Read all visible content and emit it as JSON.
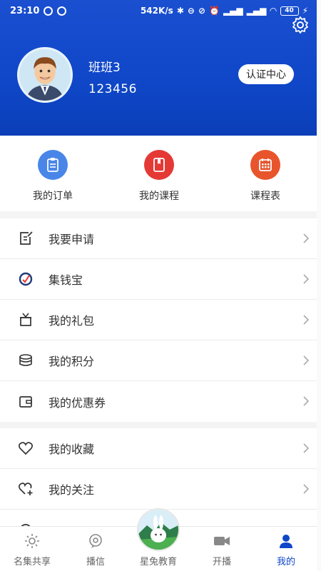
{
  "status_bar": {
    "time": "23:10",
    "speed": "542K/s",
    "battery": "40"
  },
  "profile": {
    "name": "班班3",
    "id": "123456",
    "auth_button": "认证中心"
  },
  "quick_actions": [
    {
      "label": "我的订单",
      "icon": "order-icon",
      "color": "#4a86e8"
    },
    {
      "label": "我的课程",
      "icon": "course-icon",
      "color": "#e53935"
    },
    {
      "label": "课程表",
      "icon": "calendar-icon",
      "color": "#e8552c"
    }
  ],
  "menu_group_1": [
    {
      "label": "我要申请",
      "icon": "apply-icon"
    },
    {
      "label": "集钱宝",
      "icon": "wallet-icon"
    },
    {
      "label": "我的礼包",
      "icon": "gift-icon"
    },
    {
      "label": "我的积分",
      "icon": "points-icon"
    },
    {
      "label": "我的优惠券",
      "icon": "coupon-icon"
    }
  ],
  "menu_group_2": [
    {
      "label": "我的收藏",
      "icon": "heart-icon"
    },
    {
      "label": "我的关注",
      "icon": "follow-icon"
    }
  ],
  "tabs": [
    {
      "label": "名集共享",
      "icon": "sun-icon"
    },
    {
      "label": "播信",
      "icon": "broadcast-icon"
    },
    {
      "label": "星兔教育",
      "icon": "rabbit-logo"
    },
    {
      "label": "开播",
      "icon": "camera-icon"
    },
    {
      "label": "我的",
      "icon": "person-icon"
    }
  ],
  "colors": {
    "header_blue": "#0f47c8",
    "active_tab": "#0f47c8"
  }
}
